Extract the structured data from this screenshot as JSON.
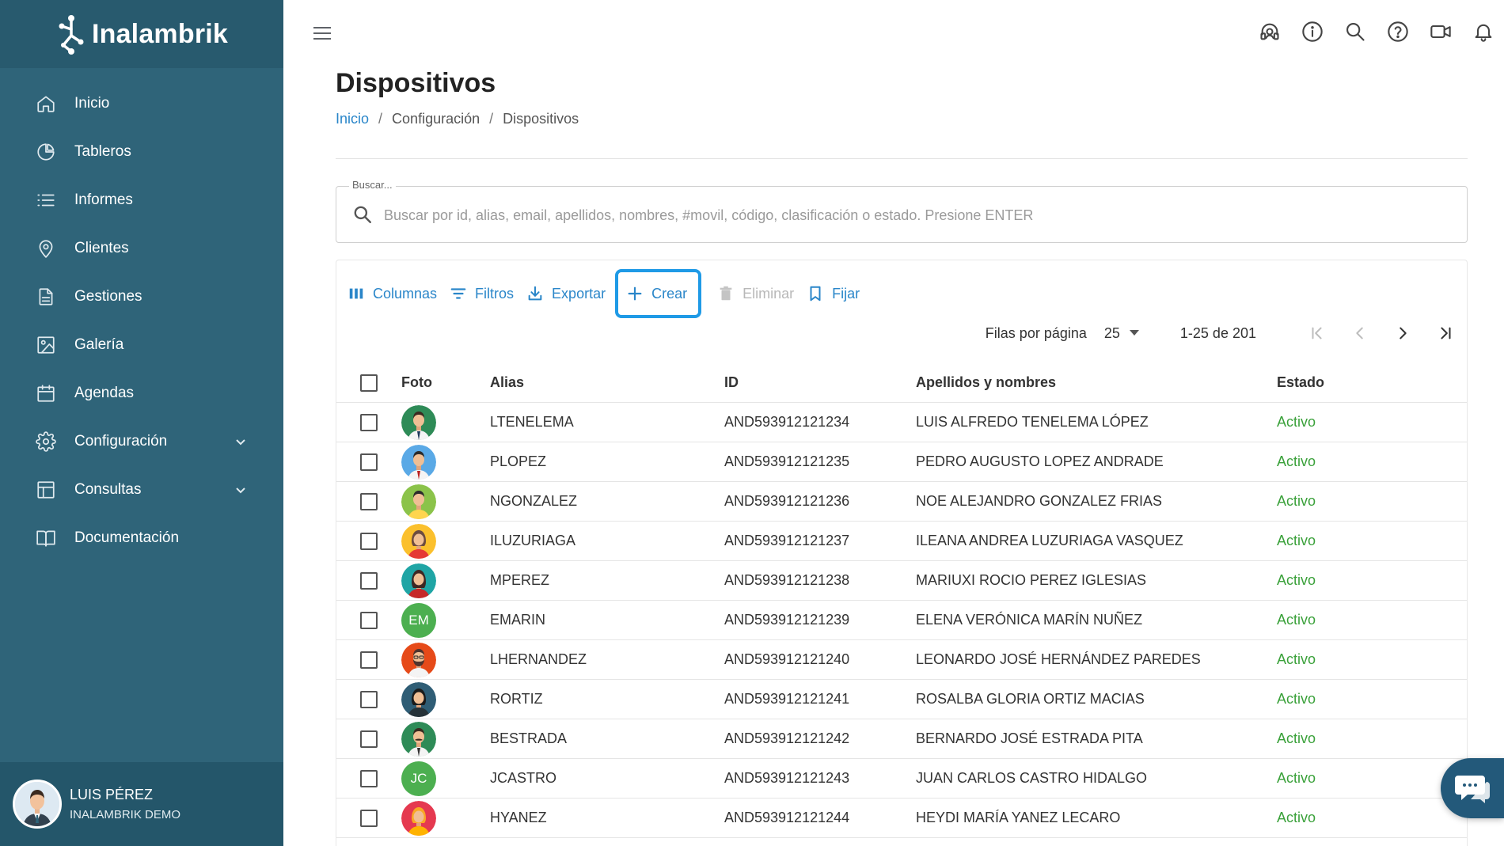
{
  "app": {
    "brand": "Inalambrik"
  },
  "sidebar": {
    "items": [
      {
        "label": "Inicio",
        "icon": "home-icon"
      },
      {
        "label": "Tableros",
        "icon": "pie-chart-icon"
      },
      {
        "label": "Informes",
        "icon": "list-icon"
      },
      {
        "label": "Clientes",
        "icon": "location-pin-icon"
      },
      {
        "label": "Gestiones",
        "icon": "document-icon"
      },
      {
        "label": "Galería",
        "icon": "image-icon"
      },
      {
        "label": "Agendas",
        "icon": "calendar-icon"
      },
      {
        "label": "Configuración",
        "icon": "gear-icon",
        "expandable": true
      },
      {
        "label": "Consultas",
        "icon": "table-icon",
        "expandable": true
      },
      {
        "label": "Documentación",
        "icon": "book-icon"
      }
    ],
    "user": {
      "name": "LUIS PÉREZ",
      "org": "INALAMBRIK DEMO"
    }
  },
  "header": {
    "icons": [
      "support-icon",
      "info-icon",
      "search-icon",
      "help-icon",
      "video-icon",
      "bell-icon"
    ]
  },
  "page": {
    "title": "Dispositivos",
    "breadcrumb": [
      "Inicio",
      "Configuración",
      "Dispositivos"
    ],
    "breadcrumb_sep": "/"
  },
  "search": {
    "legend": "Buscar...",
    "placeholder": "Buscar por id, alias, email, apellidos, nombres, #movil, código, clasificación o estado. Presione ENTER",
    "value": ""
  },
  "toolbar": {
    "columns": "Columnas",
    "filters": "Filtros",
    "export": "Exportar",
    "create": "Crear",
    "delete": "Eliminar",
    "pin": "Fijar"
  },
  "pagination": {
    "rows_label": "Filas por página",
    "rows_value": "25",
    "range": "1-25 de 201"
  },
  "table": {
    "headers": {
      "foto": "Foto",
      "alias": "Alias",
      "id": "ID",
      "name": "Apellidos y nombres",
      "estado": "Estado"
    },
    "rows": [
      {
        "alias": "LTENELEMA",
        "id": "AND593912121234",
        "name": "LUIS ALFREDO TENELEMA LÓPEZ",
        "estado": "Activo",
        "avatar": "man-suit-green"
      },
      {
        "alias": "PLOPEZ",
        "id": "AND593912121235",
        "name": "PEDRO AUGUSTO LOPEZ ANDRADE",
        "estado": "Activo",
        "avatar": "man-suit-blue"
      },
      {
        "alias": "NGONZALEZ",
        "id": "AND593912121236",
        "name": "NOE ALEJANDRO GONZALEZ FRIAS",
        "estado": "Activo",
        "avatar": "man-yellow"
      },
      {
        "alias": "ILUZURIAGA",
        "id": "AND593912121237",
        "name": "ILEANA ANDREA LUZURIAGA VASQUEZ",
        "estado": "Activo",
        "avatar": "woman-yellow"
      },
      {
        "alias": "MPEREZ",
        "id": "AND593912121238",
        "name": "MARIUXI ROCIO PEREZ IGLESIAS",
        "estado": "Activo",
        "avatar": "woman-teal"
      },
      {
        "alias": "EMARIN",
        "id": "AND593912121239",
        "name": "ELENA VERÓNICA MARÍN NUÑEZ",
        "estado": "Activo",
        "initials": "EM"
      },
      {
        "alias": "LHERNANDEZ",
        "id": "AND593912121240",
        "name": "LEONARDO JOSÉ HERNÁNDEZ PAREDES",
        "estado": "Activo",
        "avatar": "man-beard-orange"
      },
      {
        "alias": "RORTIZ",
        "id": "AND593912121241",
        "name": "ROSALBA GLORIA ORTIZ MACIAS",
        "estado": "Activo",
        "avatar": "woman-dark"
      },
      {
        "alias": "BESTRADA",
        "id": "AND593912121242",
        "name": "BERNARDO JOSÉ ESTRADA PITA",
        "estado": "Activo",
        "avatar": "man-mustache-green"
      },
      {
        "alias": "JCASTRO",
        "id": "AND593912121243",
        "name": "JUAN CARLOS CASTRO HIDALGO",
        "estado": "Activo",
        "initials": "JC"
      },
      {
        "alias": "HYANEZ",
        "id": "AND593912121244",
        "name": "HEYDI MARÍA YANEZ LECARO",
        "estado": "Activo",
        "avatar": "woman-red"
      }
    ]
  },
  "colors": {
    "sidebar": "#2f6479",
    "accent": "#2a86c9",
    "highlight": "#1f9ae6",
    "status_active": "#3aa13a"
  }
}
